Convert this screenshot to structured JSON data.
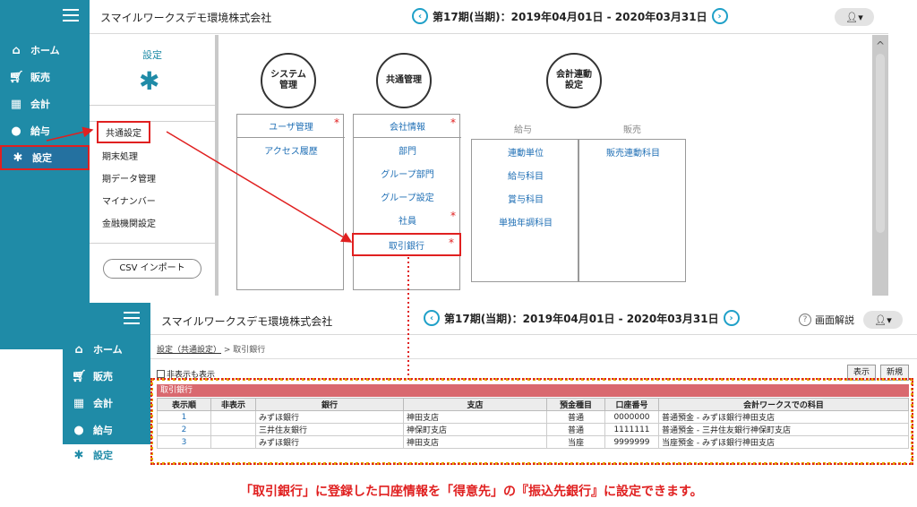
{
  "back": {
    "company": "スマイルワークスデモ環境株式会社",
    "period": "第17期(当期)：2019年04月01日 - 2020年03月31日",
    "sidebar": [
      {
        "label": "ホーム",
        "icon": "home-icon"
      },
      {
        "label": "販売",
        "icon": "cart-icon"
      },
      {
        "label": "会計",
        "icon": "calculator-icon"
      },
      {
        "label": "給与",
        "icon": "money-bag-icon"
      },
      {
        "label": "設定",
        "icon": "gear-icon"
      }
    ],
    "settings_panel": {
      "title": "設定",
      "items": [
        "共通設定",
        "期末処理",
        "期データ管理",
        "マイナンバー",
        "金融機関設定"
      ],
      "csv_button": "CSV インポート"
    },
    "headers": {
      "system": "システム\n管理",
      "common": "共通管理",
      "link": "会計連動\n設定",
      "salary": "給与",
      "sales": "販売"
    },
    "system_items": [
      "ユーザ管理",
      "アクセス履歴"
    ],
    "common_items": [
      "会社情報",
      "部門",
      "グループ部門",
      "グループ設定",
      "社員",
      "取引銀行"
    ],
    "salary_items": [
      "連動単位",
      "給与科目",
      "賞与科目",
      "単独年調科目"
    ],
    "sales_items": [
      "販売連動科目"
    ],
    "required_mark": "*"
  },
  "front": {
    "company": "スマイルワークスデモ環境株式会社",
    "period": "第17期(当期)：2019年04月01日 - 2020年03月31日",
    "help": "画面解説",
    "breadcrumb_link": "設定（共通設定）",
    "breadcrumb_current": "> 取引銀行",
    "checkbox_label": "非表示も表示",
    "btn_show": "表示",
    "btn_new": "新規",
    "table_title": "取引銀行",
    "columns": [
      "表示順",
      "非表示",
      "銀行",
      "支店",
      "預金種目",
      "口座番号",
      "会計ワークスでの科目"
    ],
    "rows": [
      [
        "1",
        "",
        "みずほ銀行",
        "神田支店",
        "普通",
        "0000000",
        "普通預金 - みずほ銀行神田支店"
      ],
      [
        "2",
        "",
        "三井住友銀行",
        "神保町支店",
        "普通",
        "1111111",
        "普通預金 - 三井住友銀行神保町支店"
      ],
      [
        "3",
        "",
        "みずほ銀行",
        "神田支店",
        "当座",
        "9999999",
        "当座預金 - みずほ銀行神田支店"
      ]
    ]
  },
  "caption": "「取引銀行」に登録した口座情報を「得意先」の『振込先銀行』に設定できます。",
  "colors": {
    "sidebar": "#1f8ba7",
    "accent": "#1fa0c8",
    "highlight": "#e02020",
    "table_header": "#d9696f"
  }
}
